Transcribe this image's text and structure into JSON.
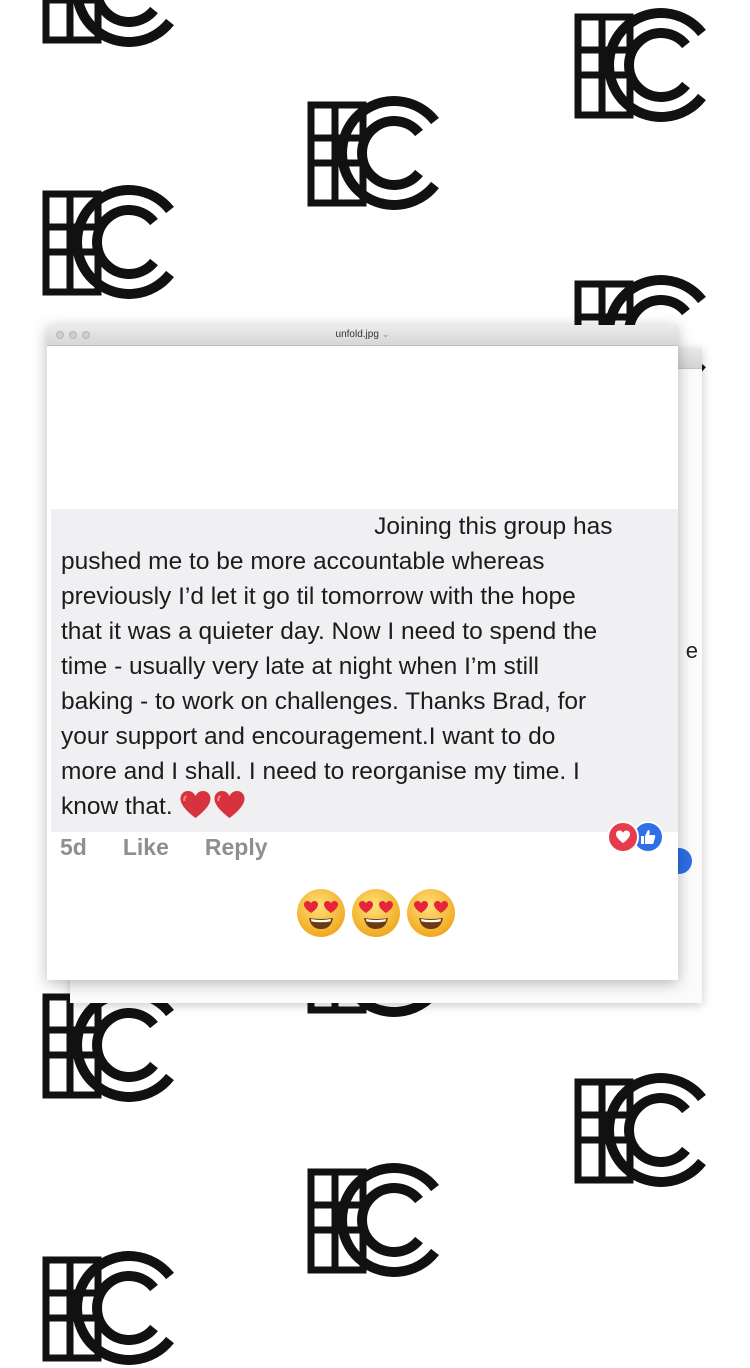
{
  "background": {
    "brand_mark": "FC",
    "color": "#111111"
  },
  "window": {
    "title": "unfold.jpg",
    "title_chevron": "⌄"
  },
  "back_window": {
    "peek_letter": "e"
  },
  "comment": {
    "text": "                                              Joining this group has\npushed me to be more accountable whereas\npreviously I’d let it go til tomorrow with the hope\nthat it was a quieter day. Now I need to spend the\ntime - usually very late at night when I’m still\nbaking - to work on challenges. Thanks Brad, for\nyour support and encouragement.I want to do\nmore and I shall. I need to reorganise my time. I\nknow that.",
    "trailing_emojis": [
      "heart-icon",
      "heart-icon"
    ],
    "time_ago": "5d",
    "like_label": "Like",
    "reply_label": "Reply",
    "reactions": [
      "love-reaction-icon",
      "like-reaction-icon"
    ]
  },
  "emoji_row": [
    "heart-eyes-emoji",
    "heart-eyes-emoji",
    "heart-eyes-emoji"
  ],
  "colors": {
    "bubble": "#f0f0f3",
    "love": "#e63a4d",
    "like": "#2f6fe8",
    "action_text": "#8f8f93"
  }
}
